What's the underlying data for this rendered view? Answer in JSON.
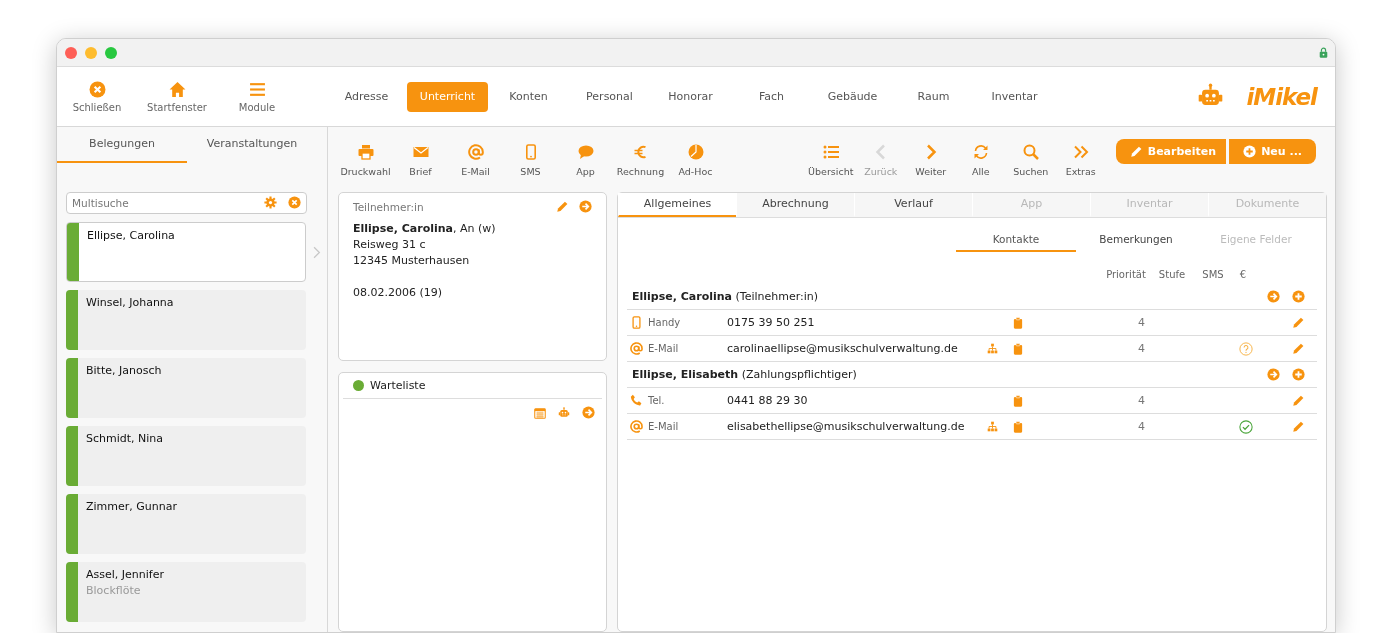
{
  "app_bar": {
    "actions": [
      {
        "label": "Schließen",
        "kind": "close"
      },
      {
        "label": "Startfenster",
        "kind": "home"
      },
      {
        "label": "Module",
        "kind": "menu"
      }
    ],
    "modules": [
      {
        "label": "Adresse",
        "selected": false
      },
      {
        "label": "Unterricht",
        "selected": true
      },
      {
        "label": "Konten",
        "selected": false
      },
      {
        "label": "Personal",
        "selected": false
      },
      {
        "label": "Honorar",
        "selected": false
      },
      {
        "label": "Fach",
        "selected": false
      },
      {
        "label": "Gebäude",
        "selected": false
      },
      {
        "label": "Raum",
        "selected": false
      },
      {
        "label": "Inventar",
        "selected": false
      }
    ],
    "logo": "iMikel"
  },
  "sidebar": {
    "tabs": [
      {
        "label": "Belegungen",
        "selected": true
      },
      {
        "label": "Veranstaltungen",
        "selected": false
      }
    ],
    "search": {
      "placeholder": "Multisuche"
    },
    "items": [
      {
        "name": "Ellipse, Carolina",
        "selected": true,
        "color": "#6aac35"
      },
      {
        "name": "Winsel, Johanna",
        "selected": false,
        "color": "#6aac35"
      },
      {
        "name": "Bitte, Janosch",
        "selected": false,
        "color": "#6aac35"
      },
      {
        "name": "Schmidt, Nina",
        "selected": false,
        "color": "#6aac35"
      },
      {
        "name": "Zimmer, Gunnar",
        "selected": false,
        "color": "#6aac35"
      },
      {
        "name": "Assel, Jennifer",
        "detail": "Blockflöte",
        "selected": false,
        "color": "#6aac35"
      }
    ]
  },
  "toolbar": {
    "actions": [
      {
        "label": "Druckwahl",
        "kind": "print"
      },
      {
        "label": "Brief",
        "kind": "letter"
      },
      {
        "label": "E-Mail",
        "kind": "email"
      },
      {
        "label": "SMS",
        "kind": "mobile"
      },
      {
        "label": "App",
        "kind": "chat"
      },
      {
        "label": "Rechnung",
        "kind": "euro"
      },
      {
        "label": "Ad-Hoc",
        "kind": "pie"
      }
    ],
    "nav": [
      {
        "label": "Übersicht",
        "kind": "list",
        "disabled": false
      },
      {
        "label": "Zurück",
        "kind": "back",
        "disabled": true
      },
      {
        "label": "Weiter",
        "kind": "forward",
        "disabled": false
      },
      {
        "label": "Alle",
        "kind": "refresh",
        "disabled": false
      },
      {
        "label": "Suchen",
        "kind": "search",
        "disabled": false
      },
      {
        "label": "Extras",
        "kind": "more",
        "disabled": false
      }
    ],
    "buttons": [
      {
        "label": "Bearbeiten",
        "kind": "edit"
      },
      {
        "label": "Neu ...",
        "kind": "new"
      }
    ]
  },
  "participant_card": {
    "heading": "Teilnehmer:in",
    "name_line": "**Ellipse, Carolina**, An (w)",
    "street": "Reisweg 31 c",
    "city": "12345 Musterhausen",
    "birth": "08.02.2006 (19)"
  },
  "waitlist_card": {
    "label": "Warteliste"
  },
  "detail": {
    "tabs": [
      {
        "label": "Allgemeines",
        "selected": true,
        "disabled": false
      },
      {
        "label": "Abrechnung",
        "selected": false,
        "disabled": false
      },
      {
        "label": "Verlauf",
        "selected": false,
        "disabled": false
      },
      {
        "label": "App",
        "selected": false,
        "disabled": true
      },
      {
        "label": "Inventar",
        "selected": false,
        "disabled": true
      },
      {
        "label": "Dokumente",
        "selected": false,
        "disabled": true
      }
    ],
    "subtabs": [
      {
        "label": "Kontakte",
        "selected": true,
        "disabled": false
      },
      {
        "label": "Bemerkungen",
        "selected": false,
        "disabled": false
      },
      {
        "label": "Eigene Felder",
        "selected": false,
        "disabled": true
      }
    ],
    "columns": [
      "Priorität",
      "Stufe",
      "SMS",
      "€"
    ],
    "groups": [
      {
        "title": "**Ellipse, Carolina** (Teilnehmer:in)",
        "contacts": [
          {
            "kind": "mobile",
            "label": "Handy",
            "value": "0175 39 50 251",
            "shared": false,
            "priority": "4",
            "payment_requested": false,
            "payment_confirmed": false
          },
          {
            "kind": "email",
            "label": "E-Mail",
            "value": "carolinaellipse@musikschulverwaltung.de",
            "shared": true,
            "priority": "4",
            "payment_requested": true,
            "payment_confirmed": false
          }
        ]
      },
      {
        "title": "**Ellipse, Elisabeth** (Zahlungspflichtiger)",
        "contacts": [
          {
            "kind": "phone",
            "label": "Tel.",
            "value": "0441 88 29 30",
            "shared": false,
            "priority": "4",
            "payment_requested": false,
            "payment_confirmed": false
          },
          {
            "kind": "email",
            "label": "E-Mail",
            "value": "elisabethellipse@musikschulverwaltung.de",
            "shared": true,
            "priority": "4",
            "payment_requested": false,
            "payment_confirmed": true
          }
        ]
      }
    ]
  }
}
